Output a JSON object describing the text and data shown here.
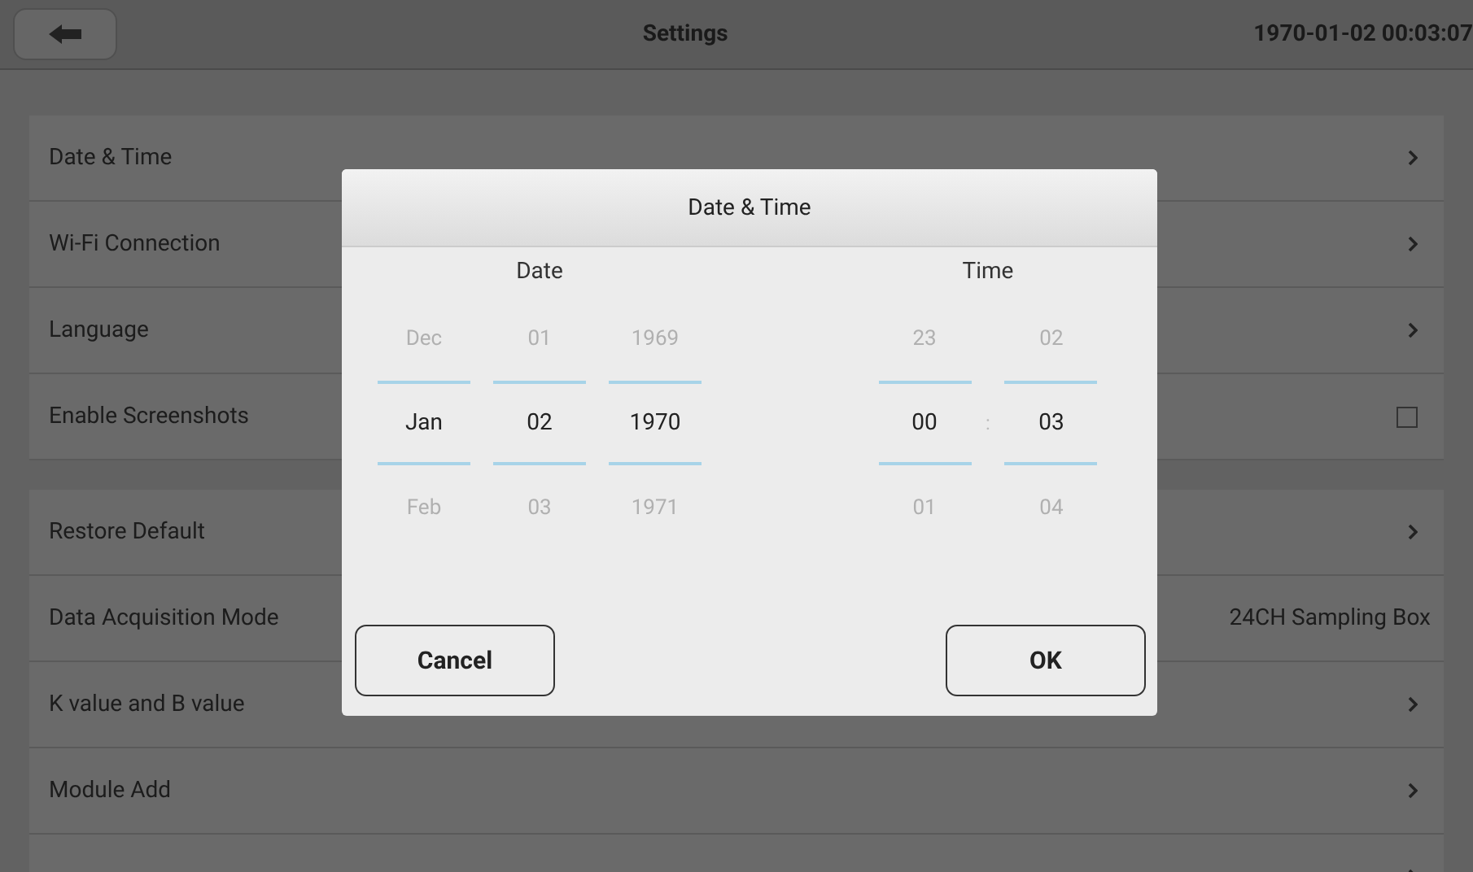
{
  "header": {
    "title": "Settings",
    "datetime": "1970-01-02 00:03:07"
  },
  "sections": [
    {
      "items": [
        {
          "label": "Date & Time",
          "kind": "chevron"
        },
        {
          "label": "Wi-Fi Connection",
          "kind": "chevron"
        },
        {
          "label": "Language",
          "kind": "chevron"
        },
        {
          "label": "Enable Screenshots",
          "kind": "checkbox",
          "checked": false
        }
      ]
    },
    {
      "items": [
        {
          "label": "Restore Default",
          "kind": "chevron"
        },
        {
          "label": "Data Acquisition Mode",
          "kind": "value",
          "value": "24CH Sampling Box"
        },
        {
          "label": "K value and B value",
          "kind": "chevron"
        },
        {
          "label": "Module Add",
          "kind": "chevron"
        },
        {
          "kind": "chevron"
        }
      ]
    }
  ],
  "dialog": {
    "title": "Date & Time",
    "date": {
      "label": "Date",
      "columns": [
        {
          "prev": "Dec",
          "current": "Jan",
          "next": "Feb"
        },
        {
          "prev": "01",
          "current": "02",
          "next": "03"
        },
        {
          "prev": "1969",
          "current": "1970",
          "next": "1971"
        }
      ]
    },
    "time": {
      "label": "Time",
      "separator": ":",
      "columns": [
        {
          "prev": "23",
          "current": "00",
          "next": "01"
        },
        {
          "prev": "02",
          "current": "03",
          "next": "04"
        }
      ]
    },
    "buttons": [
      "Cancel",
      "OK"
    ]
  }
}
